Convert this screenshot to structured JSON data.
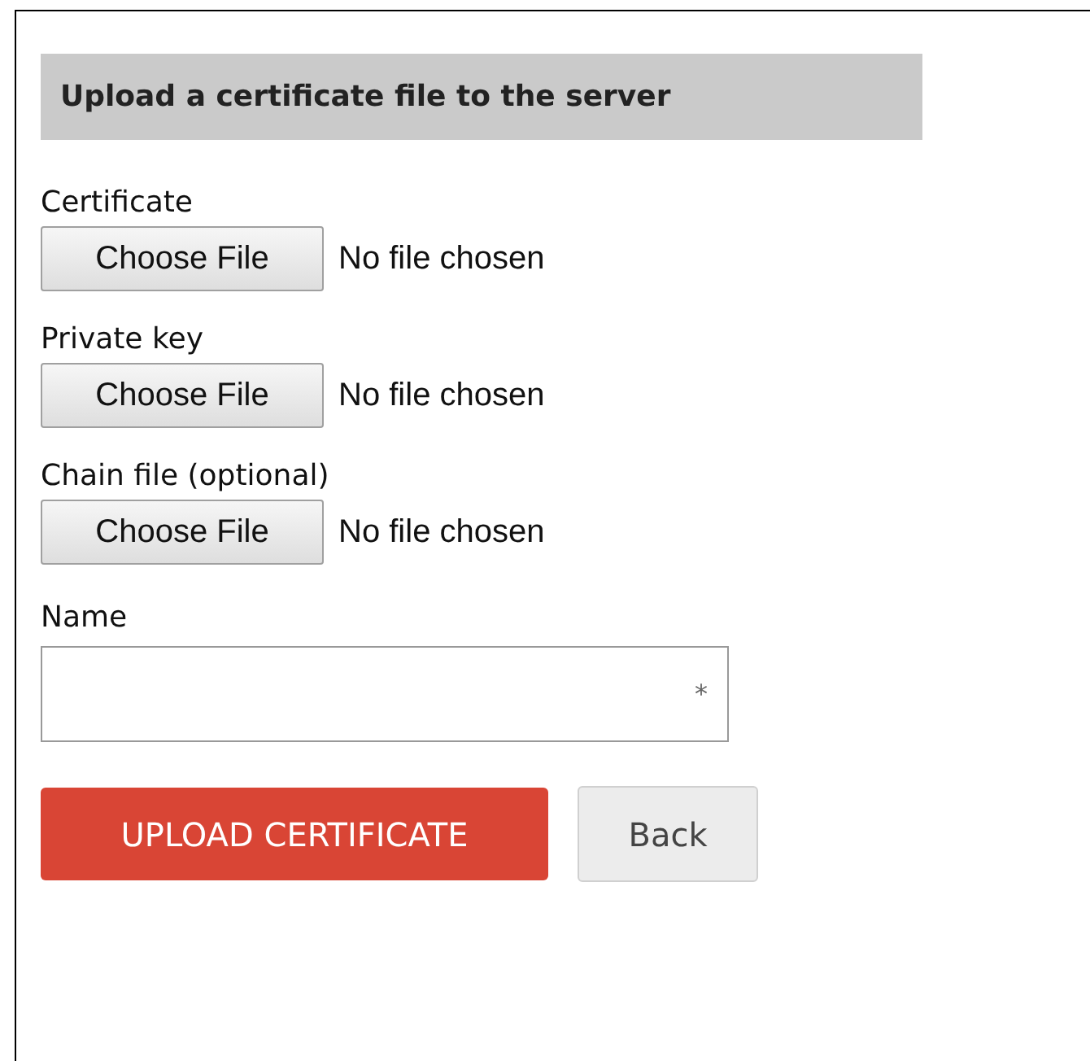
{
  "heading": "Upload a certificate file to the server",
  "file_fields": [
    {
      "label": "Certificate",
      "button": "Choose File",
      "status": "No file chosen"
    },
    {
      "label": "Private key",
      "button": "Choose File",
      "status": "No file chosen"
    },
    {
      "label": "Chain file (optional)",
      "button": "Choose File",
      "status": "No file chosen"
    }
  ],
  "name_field": {
    "label": "Name",
    "required_mark": "*"
  },
  "buttons": [
    {
      "label": "UPLOAD CERTIFICATE",
      "kind": "primary"
    },
    {
      "label": "Back",
      "kind": "secondary"
    }
  ]
}
